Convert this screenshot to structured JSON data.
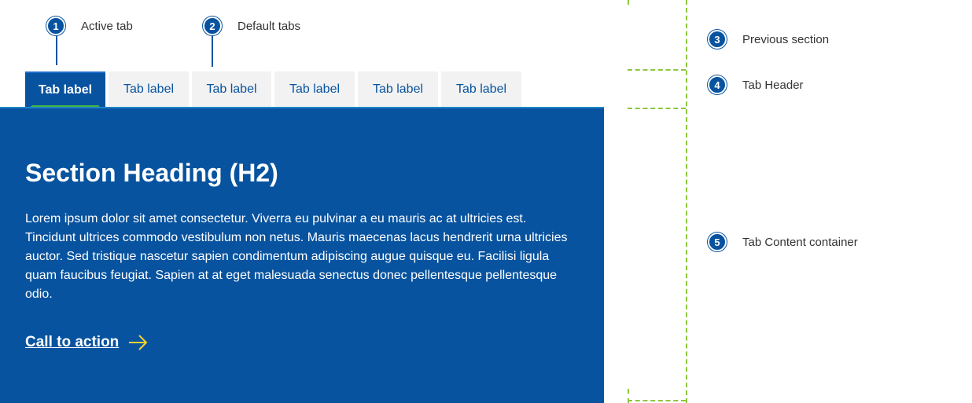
{
  "callouts": {
    "c1": {
      "num": "1",
      "label": "Active tab"
    },
    "c2": {
      "num": "2",
      "label": "Default tabs"
    },
    "c3": {
      "num": "3",
      "label": "Previous section"
    },
    "c4": {
      "num": "4",
      "label": "Tab Header"
    },
    "c5": {
      "num": "5",
      "label": "Tab Content container"
    }
  },
  "tabs": [
    {
      "label": "Tab label",
      "active": true
    },
    {
      "label": "Tab label",
      "active": false
    },
    {
      "label": "Tab label",
      "active": false
    },
    {
      "label": "Tab label",
      "active": false
    },
    {
      "label": "Tab label",
      "active": false
    },
    {
      "label": "Tab label",
      "active": false
    }
  ],
  "content": {
    "heading": "Section Heading (H2)",
    "body": "Lorem ipsum dolor sit amet consectetur. Viverra eu pulvinar a eu mauris ac at ultricies est. Tincidunt ultrices commodo vestibulum non netus. Mauris maecenas lacus hendrerit urna ultricies auctor. Sed tristique nascetur sapien condimentum adipiscing augue quisque eu. Facilisi ligula quam faucibus feugiat. Sapien at at eget malesuada senectus donec pellentesque pellentesque odio.",
    "cta_label": "Call to action"
  },
  "icons": {
    "cta": "arrow-right-icon"
  },
  "colors": {
    "primary": "#08539f",
    "active_indicator": "#44b545",
    "cta_arrow": "#f2d22e",
    "guide_lines": "#8dc63f"
  }
}
